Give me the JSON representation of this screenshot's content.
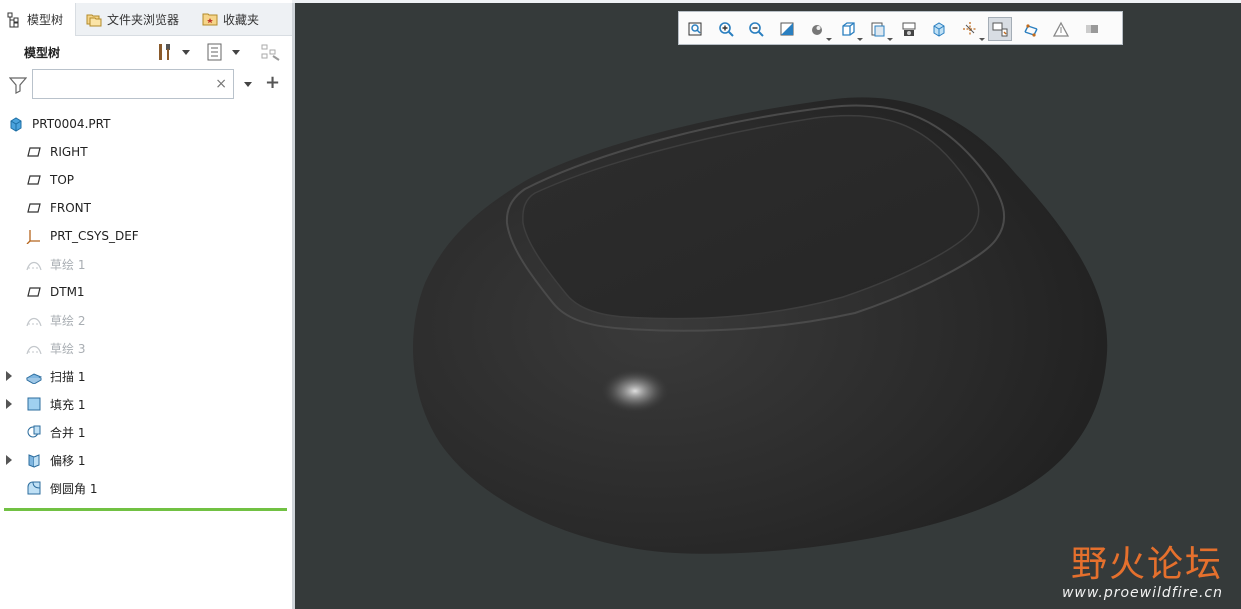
{
  "tabs": [
    {
      "label": "模型树",
      "icon": "model-tree-icon"
    },
    {
      "label": "文件夹浏览器",
      "icon": "folder-browser-icon"
    },
    {
      "label": "收藏夹",
      "icon": "favorites-icon"
    }
  ],
  "panel": {
    "title": "模型树",
    "settings_icon": "tools-icon",
    "columns_icon": "tree-columns-icon",
    "filter_icon": "filter-icon",
    "search_value": "",
    "search_placeholder": "",
    "clear_icon": "×",
    "add_icon": "+"
  },
  "tree": {
    "root": {
      "label": "PRT0004.PRT",
      "icon": "part-icon"
    },
    "items": [
      {
        "label": "RIGHT",
        "icon": "datum-plane-icon",
        "dim": false,
        "expandable": false
      },
      {
        "label": "TOP",
        "icon": "datum-plane-icon",
        "dim": false,
        "expandable": false
      },
      {
        "label": "FRONT",
        "icon": "datum-plane-icon",
        "dim": false,
        "expandable": false
      },
      {
        "label": "PRT_CSYS_DEF",
        "icon": "csys-icon",
        "dim": false,
        "expandable": false
      },
      {
        "label": "草绘 1",
        "icon": "sketch-icon",
        "dim": true,
        "expandable": false
      },
      {
        "label": "DTM1",
        "icon": "datum-plane-icon",
        "dim": false,
        "expandable": false
      },
      {
        "label": "草绘 2",
        "icon": "sketch-icon",
        "dim": true,
        "expandable": false
      },
      {
        "label": "草绘 3",
        "icon": "sketch-icon",
        "dim": true,
        "expandable": false
      },
      {
        "label": "扫描 1",
        "icon": "sweep-icon",
        "dim": false,
        "expandable": true
      },
      {
        "label": "填充 1",
        "icon": "fill-icon",
        "dim": false,
        "expandable": true
      },
      {
        "label": "合并 1",
        "icon": "merge-icon",
        "dim": false,
        "expandable": false
      },
      {
        "label": "偏移 1",
        "icon": "offset-icon",
        "dim": false,
        "expandable": true
      },
      {
        "label": "倒圆角 1",
        "icon": "round-icon",
        "dim": false,
        "expandable": false
      }
    ]
  },
  "view_toolbar": {
    "buttons": [
      "refit-icon",
      "zoom-in-icon",
      "zoom-out-icon",
      "repaint-icon",
      "display-style-icon",
      "saved-orientations-icon",
      "view-manager-icon",
      "perspective-view-icon",
      "spin-center-icon",
      "datum-display-icon",
      "annotation-display-icon",
      "plane-display-icon",
      "axis-display-icon",
      "point-display-icon"
    ],
    "active": "annotation-display-icon"
  },
  "watermark": {
    "title": "野火论坛",
    "url": "www.proewildfire.cn"
  },
  "colors": {
    "viewport_bg": "#353a3a",
    "model": "#2b2b2b",
    "accent_green": "#71c143",
    "watermark_orange": "#e5702d"
  }
}
